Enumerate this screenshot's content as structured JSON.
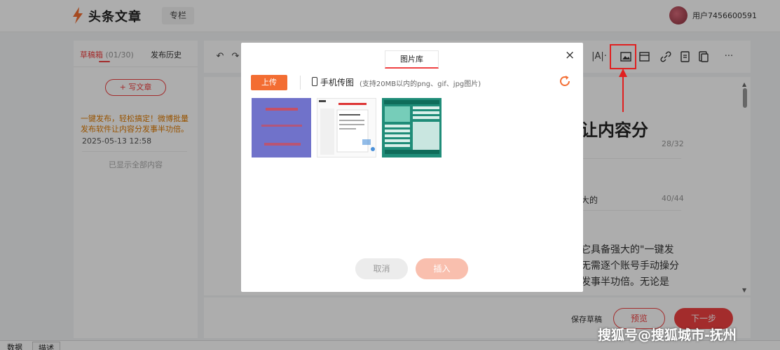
{
  "header": {
    "logo_text": "头条文章",
    "column_label": "专栏",
    "username": "用户7456600591"
  },
  "sidebar": {
    "tab_drafts": "草稿箱",
    "tab_drafts_count": "(01/30)",
    "tab_history": "发布历史",
    "write_button": "写文章",
    "draft_title": "一键发布，轻松搞定！微博批量发布软件让内容分发事半功倍。",
    "draft_date": "2025-05-13 12:58",
    "all_shown": "已显示全部内容"
  },
  "editor": {
    "title_fragment": "让内容分",
    "title_count": "28/32",
    "subtitle_fragment": "大的",
    "subtitle_count": "40/44",
    "body_fragment": "它具备强大的\"一键发无需逐个账号手动操分发事半功倍。无论是"
  },
  "bottombar": {
    "save_draft": "保存草稿",
    "preview": "预览",
    "next": "下一步"
  },
  "bottom_strip": {
    "tab1": "数据",
    "tab2": "描述"
  },
  "modal": {
    "tab_label": "图片库",
    "close": "×",
    "upload": "上传",
    "phone_label": "手机传图",
    "phone_hint": "(支持20MB以内的png、gif、jpg图片)",
    "cancel": "取消",
    "insert": "插入",
    "thumbnails": [
      {
        "name": "thumbnail-1",
        "color": "#6b7bd4"
      },
      {
        "name": "thumbnail-2",
        "color": "#f5f5f5"
      },
      {
        "name": "thumbnail-3",
        "color": "#1f8c78"
      }
    ]
  },
  "toolbar": {
    "icons": [
      "undo-icon",
      "redo-icon",
      "heading-icon",
      "image-icon",
      "video-icon",
      "link-icon",
      "audio-icon",
      "template-icon",
      "more-icon"
    ]
  },
  "watermark": "搜狐号@搜狐城市-抚州",
  "colors": {
    "accent": "#f04142",
    "upload": "#f36d32",
    "annotation": "#e02020"
  }
}
